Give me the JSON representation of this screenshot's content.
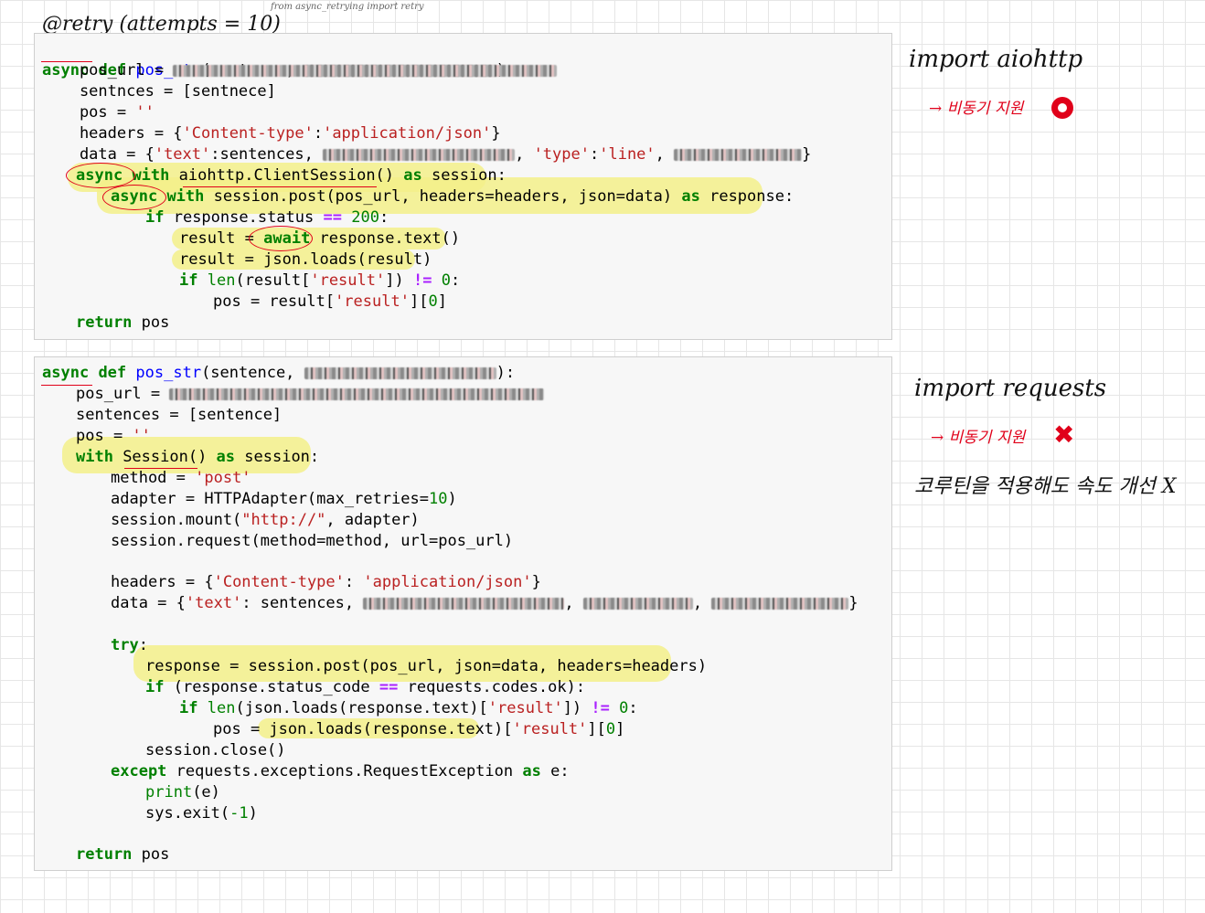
{
  "annotations": {
    "decorator": "@retry (attempts = 10)",
    "from_note": "from async_retrying import retry",
    "import1": "import aiohttp",
    "note1": "→ 비동기 지원",
    "import2": "import requests",
    "note2": "→ 비동기 지원",
    "note3": "코루틴을 적용해도 속도 개선 X"
  },
  "cell1": {
    "l1": {
      "kw_async": "async",
      "kw_def": "def",
      "fn": "pos_str",
      "text": "(sentence, ",
      "end": "):"
    },
    "l2": {
      "text": "    pos_url = "
    },
    "l3": {
      "text": "    sentnces = [sentnece]"
    },
    "l4": {
      "text": "    pos = ",
      "str": "''"
    },
    "l5": {
      "a": "    headers = {",
      "s1": "'Content-type'",
      "b": ":",
      "s2": "'application/json'",
      "c": "}"
    },
    "l6": {
      "a": "    data = {",
      "s1": "'text'",
      "b": ":sentences, ",
      "s2": "'type'",
      "c": ":",
      "s3": "'line'",
      "d": ", ",
      "e": "}"
    },
    "l7": {
      "kw": "async",
      "kw2": "with",
      "text": " aiohttp.ClientSession() ",
      "kw3": "as",
      "text2": " session:"
    },
    "l8": {
      "kw": "async",
      "kw2": "with",
      "text": " session.post(pos_url, headers=headers, json=data) ",
      "kw3": "as",
      "text2": " response:"
    },
    "l9": {
      "kw": "if",
      "text": " response.status ",
      "op": "==",
      "num": "200",
      "end": ":"
    },
    "l10": {
      "text": "result = ",
      "kw": "await",
      "text2": " response.text()"
    },
    "l11": {
      "text": "result = json.loads(result)"
    },
    "l12": {
      "kw": "if",
      "bi": "len",
      "a": "(result[",
      "s": "'result'",
      "b": "]) ",
      "op": "!=",
      "num": "0",
      "end": ":"
    },
    "l13": {
      "a": "pos = result[",
      "s": "'result'",
      "b": "][",
      "num": "0",
      "end": "]"
    },
    "l14": {
      "kw": "return",
      "text": " pos"
    }
  },
  "cell2": {
    "l1": {
      "kw_async": "async",
      "kw_def": "def",
      "fn": "pos_str",
      "text": "(sentence, ",
      "end": "):"
    },
    "l2": {
      "text": "pos_url = "
    },
    "l3": {
      "text": "sentences = [sentence]"
    },
    "l4": {
      "text": "pos = ",
      "str": "''"
    },
    "l5": {
      "kw": "with",
      "text": " Session() ",
      "kw2": "as",
      "text2": " session:"
    },
    "l6": {
      "text": "method = ",
      "str": "'post'"
    },
    "l7": {
      "a": "adapter = HTTPAdapter(max_retries=",
      "num": "10",
      "b": ")"
    },
    "l8": {
      "a": "session.mount(",
      "s": "\"http://\"",
      "b": ", adapter)"
    },
    "l9": {
      "text": "session.request(method=method, url=pos_url)"
    },
    "l10": {
      "a": "headers = {",
      "s1": "'Content-type'",
      "b": ": ",
      "s2": "'application/json'",
      "c": "}"
    },
    "l11": {
      "a": "data = {",
      "s1": "'text'",
      "b": ": sentences, ",
      "c": ", ",
      "d": ", ",
      "e": "}"
    },
    "l12": {
      "kw": "try",
      "end": ":"
    },
    "l13": {
      "text": "response = session.post(pos_url, json=data, headers=headers)"
    },
    "l14": {
      "kw": "if",
      "text": " (response.status_code ",
      "op": "==",
      "text2": " requests.codes.ok):"
    },
    "l15": {
      "kw": "if",
      "bi": "len",
      "a": "(json.loads(response.text)[",
      "s": "'result'",
      "b": "]) ",
      "op": "!=",
      "num": "0",
      "end": ":"
    },
    "l16": {
      "a": "pos = json.loads(response.text)[",
      "s": "'result'",
      "b": "][",
      "num": "0",
      "end": "]"
    },
    "l17": {
      "text": "session.close()"
    },
    "l18": {
      "kw": "except",
      "text": " requests.exceptions.RequestException ",
      "kw2": "as",
      "text2": " e:"
    },
    "l19": {
      "bi": "print",
      "text": "(e)"
    },
    "l20": {
      "a": "sys.exit(",
      "num": "-1",
      "b": ")"
    },
    "l21": {
      "kw": "return",
      "text": " pos"
    }
  }
}
